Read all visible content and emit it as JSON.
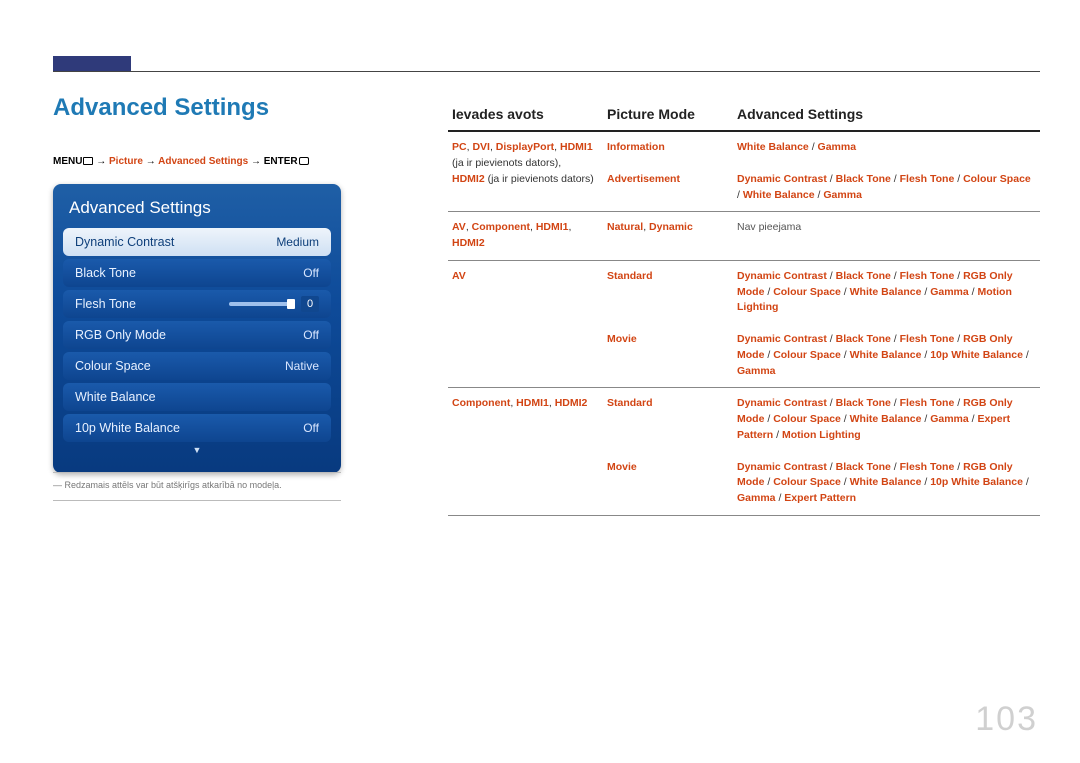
{
  "page": {
    "title": "Advanced Settings",
    "number": "103"
  },
  "breadcrumb": {
    "menu": "MENU",
    "arrow": " → ",
    "picture": "Picture",
    "adv": "Advanced Settings",
    "enter": "ENTER"
  },
  "osd": {
    "title": "Advanced Settings",
    "rows": [
      {
        "label": "Dynamic Contrast",
        "value": "Medium",
        "selected": true
      },
      {
        "label": "Black Tone",
        "value": "Off"
      },
      {
        "label": "Flesh Tone",
        "value": "0",
        "slider": true
      },
      {
        "label": "RGB Only Mode",
        "value": "Off"
      },
      {
        "label": "Colour Space",
        "value": "Native"
      },
      {
        "label": "White Balance",
        "value": ""
      },
      {
        "label": "10p White Balance",
        "value": "Off"
      }
    ]
  },
  "footnote": "―  Redzamais attēls var būt atšķirīgs atkarībā no modeļa.",
  "table": {
    "head": {
      "src": "Ievades avots",
      "mode": "Picture Mode",
      "adv": "Advanced Settings"
    },
    "rows": [
      {
        "src_html": "<span class='red'>PC</span><span class='black-plain'>, </span><span class='red'>DVI</span><span class='black-plain'>, </span><span class='red'>DisplayPort</span><span class='black-plain'>, </span><span class='red'>HDMI1</span><br><span class='black-plain'>(ja ir pievienots dators),</span><br><span class='red'>HDMI2</span> <span class='black-plain'>(ja ir pievienots dators)</span>",
        "mode_html": "<span class='red'>Information</span>",
        "adv_html": "<span class='red'>White Balance</span> <span class='black-plain'>/</span> <span class='red'>Gamma</span>",
        "sub": [
          {
            "mode_html": "<span class='red'>Advertisement</span>",
            "adv_html": "<span class='red'>Dynamic Contrast</span> <span class='black-plain'>/</span> <span class='red'>Black Tone</span> <span class='black-plain'>/</span> <span class='red'>Flesh Tone</span> <span class='black-plain'>/</span> <span class='red'>Colour Space</span> <span class='black-plain'>/</span> <span class='red'>White Balance</span> <span class='black-plain'>/</span> <span class='red'>Gamma</span>"
          }
        ]
      },
      {
        "src_html": "<span class='red'>AV</span><span class='black-plain'>, </span><span class='red'>Component</span><span class='black-plain'>, </span><span class='red'>HDMI1</span><span class='black-plain'>,</span><br><span class='red'>HDMI2</span>",
        "mode_html": "<span class='red'>Natural</span><span class='black-plain'>, </span><span class='red'>Dynamic</span>",
        "adv_html": "<span class='gray-plain'>Nav pieejama</span>"
      },
      {
        "src_html": "<span class='red'>AV</span>",
        "mode_html": "<span class='red'>Standard</span>",
        "adv_html": "<span class='red'>Dynamic Contrast</span> <span class='black-plain'>/</span> <span class='red'>Black Tone</span> <span class='black-plain'>/</span> <span class='red'>Flesh Tone</span> <span class='black-plain'>/</span> <span class='red'>RGB Only Mode</span> <span class='black-plain'>/</span> <span class='red'>Colour Space</span> <span class='black-plain'>/</span> <span class='red'>White Balance</span> <span class='black-plain'>/</span> <span class='red'>Gamma</span> <span class='black-plain'>/</span> <span class='red'>Motion Lighting</span>",
        "sub": [
          {
            "mode_html": "<span class='red'>Movie</span>",
            "adv_html": "<span class='red'>Dynamic Contrast</span> <span class='black-plain'>/</span> <span class='red'>Black Tone</span> <span class='black-plain'>/</span> <span class='red'>Flesh Tone</span> <span class='black-plain'>/</span> <span class='red'>RGB Only Mode</span> <span class='black-plain'>/</span> <span class='red'>Colour Space</span> <span class='black-plain'>/</span> <span class='red'>White Balance</span> <span class='black-plain'>/</span> <span class='red'>10p White Balance</span> <span class='black-plain'>/</span> <span class='red'>Gamma</span>"
          }
        ]
      },
      {
        "src_html": "<span class='red'>Component</span><span class='black-plain'>, </span><span class='red'>HDMI1</span><span class='black-plain'>, </span><span class='red'>HDMI2</span>",
        "mode_html": "<span class='red'>Standard</span>",
        "adv_html": "<span class='red'>Dynamic Contrast</span> <span class='black-plain'>/</span> <span class='red'>Black Tone</span> <span class='black-plain'>/</span> <span class='red'>Flesh Tone</span> <span class='black-plain'>/</span> <span class='red'>RGB Only Mode</span> <span class='black-plain'>/</span> <span class='red'>Colour Space</span> <span class='black-plain'>/</span> <span class='red'>White Balance</span> <span class='black-plain'>/</span> <span class='red'>Gamma</span> <span class='black-plain'>/</span> <span class='red'>Expert Pattern</span> <span class='black-plain'>/</span> <span class='red'>Motion Lighting</span>",
        "sub": [
          {
            "mode_html": "<span class='red'>Movie</span>",
            "adv_html": "<span class='red'>Dynamic Contrast</span> <span class='black-plain'>/</span> <span class='red'>Black Tone</span> <span class='black-plain'>/</span> <span class='red'>Flesh Tone</span> <span class='black-plain'>/</span> <span class='red'>RGB Only Mode</span> <span class='black-plain'>/</span> <span class='red'>Colour Space</span> <span class='black-plain'>/</span> <span class='red'>White Balance</span> <span class='black-plain'>/</span> <span class='red'>10p White Balance</span> <span class='black-plain'>/</span> <span class='red'>Gamma</span> <span class='black-plain'>/</span> <span class='red'>Expert Pattern</span>"
          }
        ]
      }
    ]
  }
}
